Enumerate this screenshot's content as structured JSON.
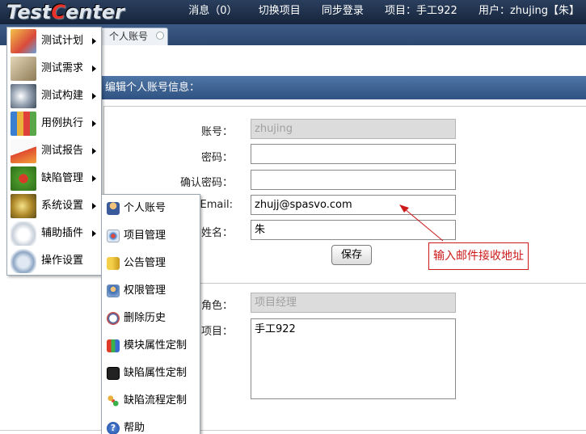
{
  "header": {
    "logo_part1": "Test",
    "logo_c": "C",
    "logo_part2": "enter",
    "nav": {
      "messages": "消息（0）",
      "switch_project": "切换项目",
      "sync_login": "同步登录",
      "project": "项目：手工922",
      "user": "用户：zhujing【朱】"
    }
  },
  "tabs": [
    {
      "label": "个人账号"
    }
  ],
  "form": {
    "title": "编辑个人账号信息：",
    "account_label": "账号：",
    "account_value": "zhujing",
    "password_label": "密码：",
    "password_value": "",
    "confirm_label": "确认密码：",
    "confirm_value": "",
    "email_label": "Email:",
    "email_value": "zhujj@spasvo.com",
    "realname_label": "实姓名：",
    "realname_value": "朱",
    "save_label": "保存",
    "role_label": "户角色：",
    "role_value": "项目经理",
    "projects_label": "与项目：",
    "projects_value": "手工922"
  },
  "annotation": {
    "text": "输入邮件接收地址",
    "color": "#cc1a1a"
  },
  "menu": {
    "items": [
      {
        "label": "测试计划",
        "icon": "test-plan-icon",
        "has_sub": true
      },
      {
        "label": "测试需求",
        "icon": "test-requirements-icon",
        "has_sub": true
      },
      {
        "label": "测试构建",
        "icon": "test-build-icon",
        "has_sub": true
      },
      {
        "label": "用例执行",
        "icon": "case-execution-icon",
        "has_sub": true
      },
      {
        "label": "测试报告",
        "icon": "test-report-icon",
        "has_sub": true
      },
      {
        "label": "缺陷管理",
        "icon": "bug-icon",
        "has_sub": true
      },
      {
        "label": "系统设置",
        "icon": "system-settings-icon",
        "has_sub": true
      },
      {
        "label": "辅助插件",
        "icon": "plugin-mouse-icon",
        "has_sub": true
      },
      {
        "label": "操作设置",
        "icon": "gear-icon",
        "has_sub": false
      }
    ]
  },
  "submenu": {
    "items": [
      {
        "label": "个人账号",
        "icon": "user-icon"
      },
      {
        "label": "项目管理",
        "icon": "project-icon"
      },
      {
        "label": "公告管理",
        "icon": "megaphone-icon"
      },
      {
        "label": "权限管理",
        "icon": "permission-icon"
      },
      {
        "label": "删除历史",
        "icon": "history-icon"
      },
      {
        "label": "模块属性定制",
        "icon": "module-blocks-icon"
      },
      {
        "label": "缺陷属性定制",
        "icon": "defect-grid-icon"
      },
      {
        "label": "缺陷流程定制",
        "icon": "workflow-icon"
      },
      {
        "label": "帮助",
        "icon": "help-icon"
      }
    ]
  }
}
